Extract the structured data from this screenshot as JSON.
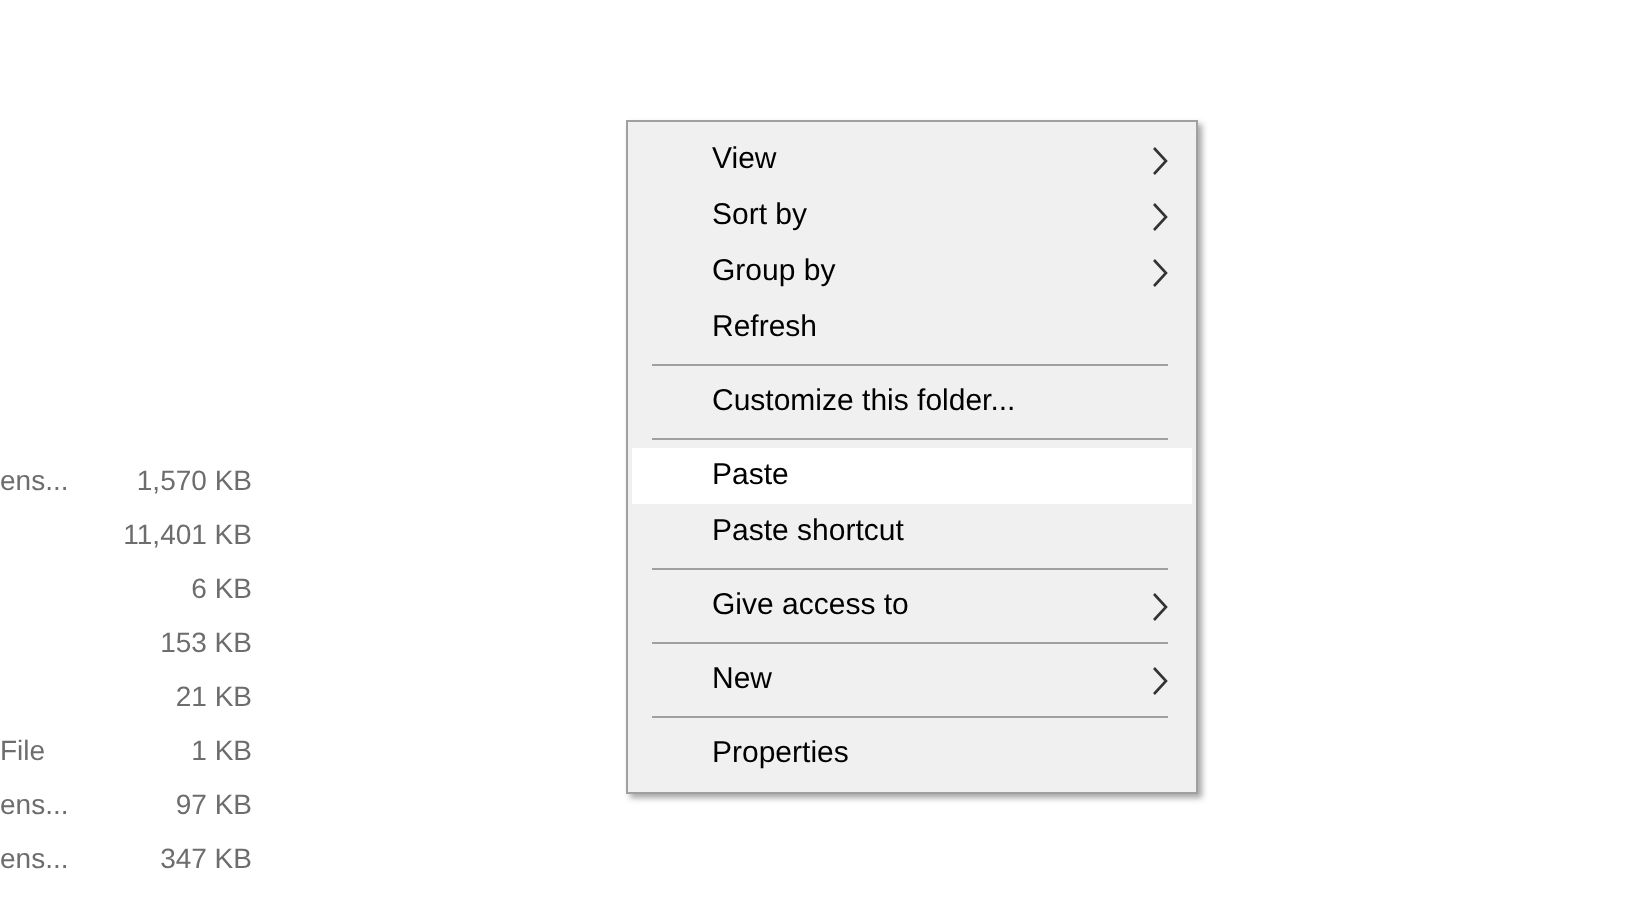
{
  "file_list": {
    "rows": [
      {
        "type": "ens...",
        "size": "1,570 KB"
      },
      {
        "type": "",
        "size": "11,401 KB"
      },
      {
        "type": "",
        "size": "6 KB"
      },
      {
        "type": "",
        "size": "153 KB"
      },
      {
        "type": "",
        "size": "21 KB"
      },
      {
        "type": "File",
        "size": "1 KB"
      },
      {
        "type": "ens...",
        "size": "97 KB"
      },
      {
        "type": "ens...",
        "size": "347 KB"
      }
    ]
  },
  "context_menu": {
    "items": [
      {
        "kind": "item",
        "label": "View",
        "submenu": true,
        "selected": false
      },
      {
        "kind": "item",
        "label": "Sort by",
        "submenu": true,
        "selected": false
      },
      {
        "kind": "item",
        "label": "Group by",
        "submenu": true,
        "selected": false
      },
      {
        "kind": "item",
        "label": "Refresh",
        "submenu": false,
        "selected": false
      },
      {
        "kind": "separator"
      },
      {
        "kind": "item",
        "label": "Customize this folder...",
        "submenu": false,
        "selected": false
      },
      {
        "kind": "separator"
      },
      {
        "kind": "item",
        "label": "Paste",
        "submenu": false,
        "selected": true
      },
      {
        "kind": "item",
        "label": "Paste shortcut",
        "submenu": false,
        "selected": false
      },
      {
        "kind": "separator"
      },
      {
        "kind": "item",
        "label": "Give access to",
        "submenu": true,
        "selected": false
      },
      {
        "kind": "separator"
      },
      {
        "kind": "item",
        "label": "New",
        "submenu": true,
        "selected": false
      },
      {
        "kind": "separator"
      },
      {
        "kind": "item",
        "label": "Properties",
        "submenu": false,
        "selected": false
      }
    ]
  }
}
